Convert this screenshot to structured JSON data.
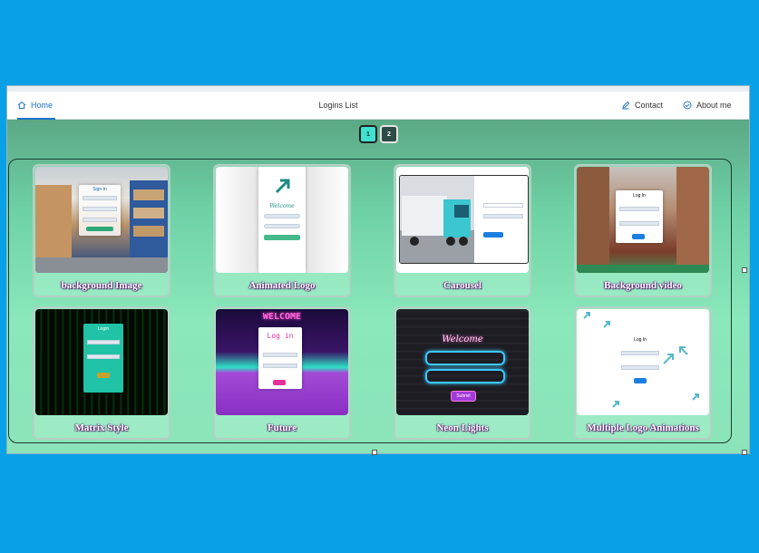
{
  "nav": {
    "home_label": "Home",
    "title": "Logins List",
    "contact_label": "Contact",
    "about_label": "About me"
  },
  "pagination": {
    "pages": [
      "1",
      "2"
    ],
    "current": "1"
  },
  "cards": [
    {
      "title": "background Image",
      "thumb": "warehouse-signin"
    },
    {
      "title": "Animated Logo",
      "thumb": "animated-logo-welcome"
    },
    {
      "title": "Carousel",
      "thumb": "truck-carousel"
    },
    {
      "title": "Background video",
      "thumb": "warehouse-login-video"
    },
    {
      "title": "Matrix Style",
      "thumb": "matrix-login"
    },
    {
      "title": "Future",
      "thumb": "retro-future-login"
    },
    {
      "title": "Neon Lights",
      "thumb": "neon-welcome"
    },
    {
      "title": "Multiple Logo Animations",
      "thumb": "arrow-logos-login"
    }
  ],
  "thumb_text": {
    "sign_in": "Sign In",
    "welcome": "Welcome",
    "login": "Log In",
    "log_in_future": "Log in",
    "welcome_neon": "WELCOME",
    "neon_script": "Welcome",
    "submit": "Submit",
    "matrix_login": "Login"
  },
  "colors": {
    "page_bg": "#0aa0e6",
    "accent": "#1a73c8",
    "content_top": "#5ba885",
    "content_bottom": "#8ce3b9",
    "active_page": "#3fe1d0"
  }
}
